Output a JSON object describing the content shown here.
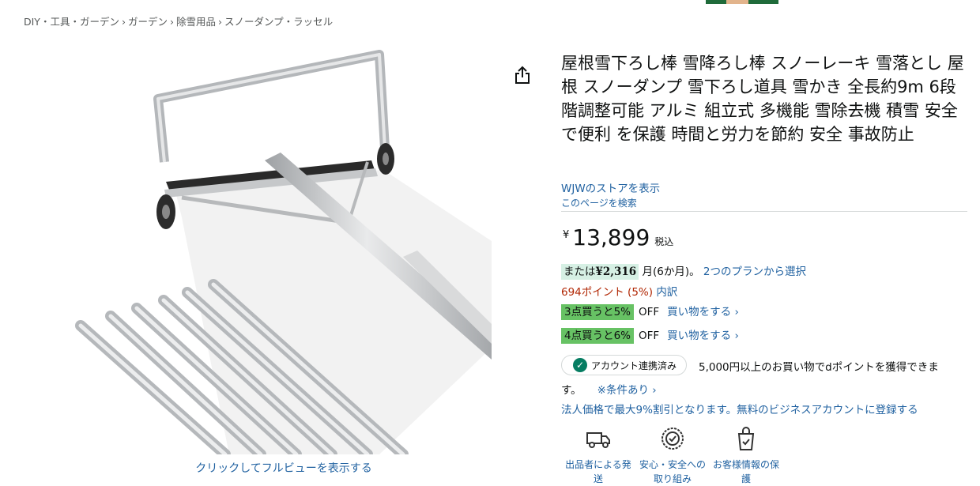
{
  "breadcrumb": [
    "DIY・工具・ガーデン",
    "ガーデン",
    "除雪用品",
    "スノーダンプ・ラッセル"
  ],
  "breadcrumb_separator": "›",
  "image_caption": "クリックしてフルビューを表示する",
  "title": "屋根雪下ろし棒 雪降ろし棒 スノーレーキ 雪落とし 屋根 スノーダンプ 雪下ろし道具 雪かき 全長約9m 6段階調整可能 アルミ 組立式 多機能 雪除去機 積雪 安全で便利 を保護 時間と労力を節約 安全 事故防止",
  "store_link": "WJWのストアを表示",
  "search_page_link": "このページを検索",
  "price": {
    "currency": "¥",
    "amount": "13,899",
    "tax_label": "税込"
  },
  "installment": {
    "prefix": "または",
    "amount": "¥2,316",
    "suffix": "月(6か月)。",
    "link": "2つのプランから選択"
  },
  "points": {
    "value": "694ポイント (5%)",
    "link": "内訳"
  },
  "promotions": [
    {
      "badge": "3点買うと5%",
      "off": "OFF",
      "link": "買い物をする ›"
    },
    {
      "badge": "4点買うと6%",
      "off": "OFF",
      "link": "買い物をする ›"
    }
  ],
  "account_badge": "アカウント連携済み",
  "dpoint_text": "5,000円以上のお買い物でdポイントを獲得できま",
  "dpoint_text_cont": "す。",
  "conditions_link": "※条件あり ›",
  "business_link": "法人価格で最大9%割引となります。無料のビジネスアカウントに登録する",
  "features": [
    {
      "icon": "truck-icon",
      "label": "出品者による発送"
    },
    {
      "icon": "shield-check-icon",
      "label": "安心・安全への取り組み"
    },
    {
      "icon": "bag-lock-icon",
      "label": "お客様情報の保護"
    }
  ],
  "colors": {
    "link": "#2162a1",
    "points": "#b12704",
    "promo_badge": "#67c264",
    "installment_bg": "#d6f0e4",
    "check": "#067d62"
  }
}
